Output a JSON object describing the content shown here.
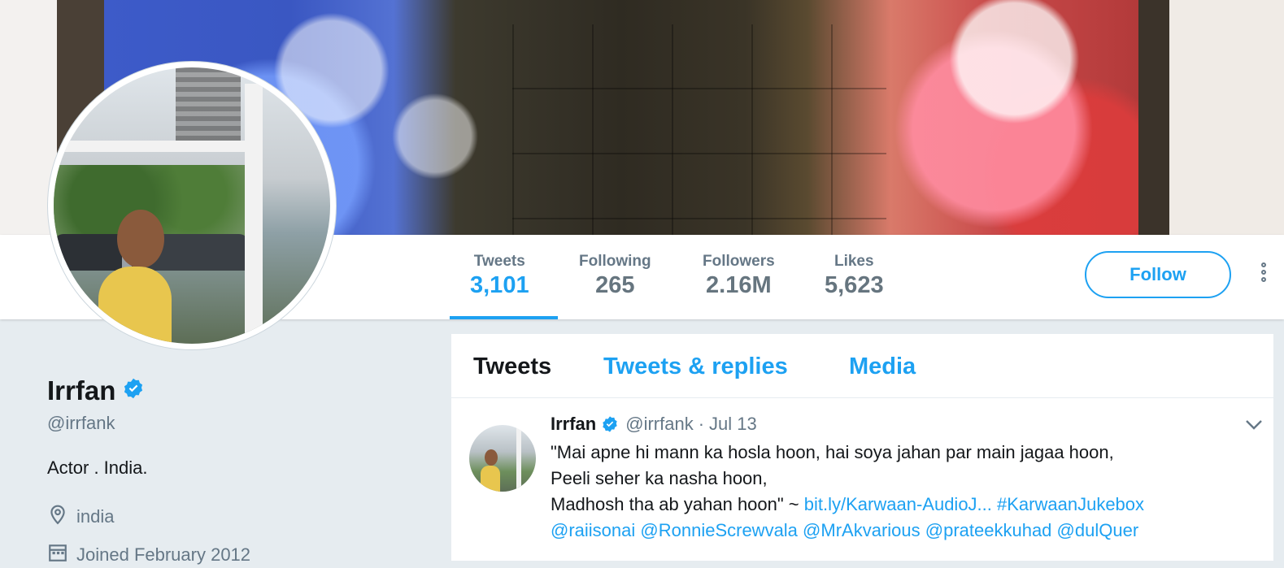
{
  "profile": {
    "name": "Irrfan",
    "handle": "@irrfank",
    "bio": "Actor . India.",
    "location": "india",
    "joined": "Joined February 2012"
  },
  "stats": [
    {
      "label": "Tweets",
      "value": "3,101",
      "active": true
    },
    {
      "label": "Following",
      "value": "265",
      "active": false
    },
    {
      "label": "Followers",
      "value": "2.16M",
      "active": false
    },
    {
      "label": "Likes",
      "value": "5,623",
      "active": false
    }
  ],
  "actions": {
    "follow_label": "Follow"
  },
  "tabs": [
    {
      "label": "Tweets",
      "active": true
    },
    {
      "label": "Tweets & replies",
      "active": false
    },
    {
      "label": "Media",
      "active": false
    }
  ],
  "tweet": {
    "name": "Irrfan",
    "handle": "@irrfank",
    "separator": "·",
    "time": "Jul 13",
    "line1": "\"Mai apne hi mann ka hosla hoon, hai soya jahan par main jagaa hoon,",
    "line2": "Peeli seher ka nasha hoon,",
    "line3_text": "Madhosh tha ab yahan hoon\" ~ ",
    "link_url": "bit.ly/Karwaan-AudioJ...",
    "hashtag": "#KarwaanJukebox",
    "mentions": [
      "@raiisonai",
      "@RonnieScrewvala",
      "@MrAkvarious",
      "@prateekkuhad",
      "@dulQuer"
    ]
  },
  "colors": {
    "accent": "#1da1f2",
    "background": "#e6ecf0",
    "text_primary": "#14171a",
    "text_secondary": "#657786"
  }
}
